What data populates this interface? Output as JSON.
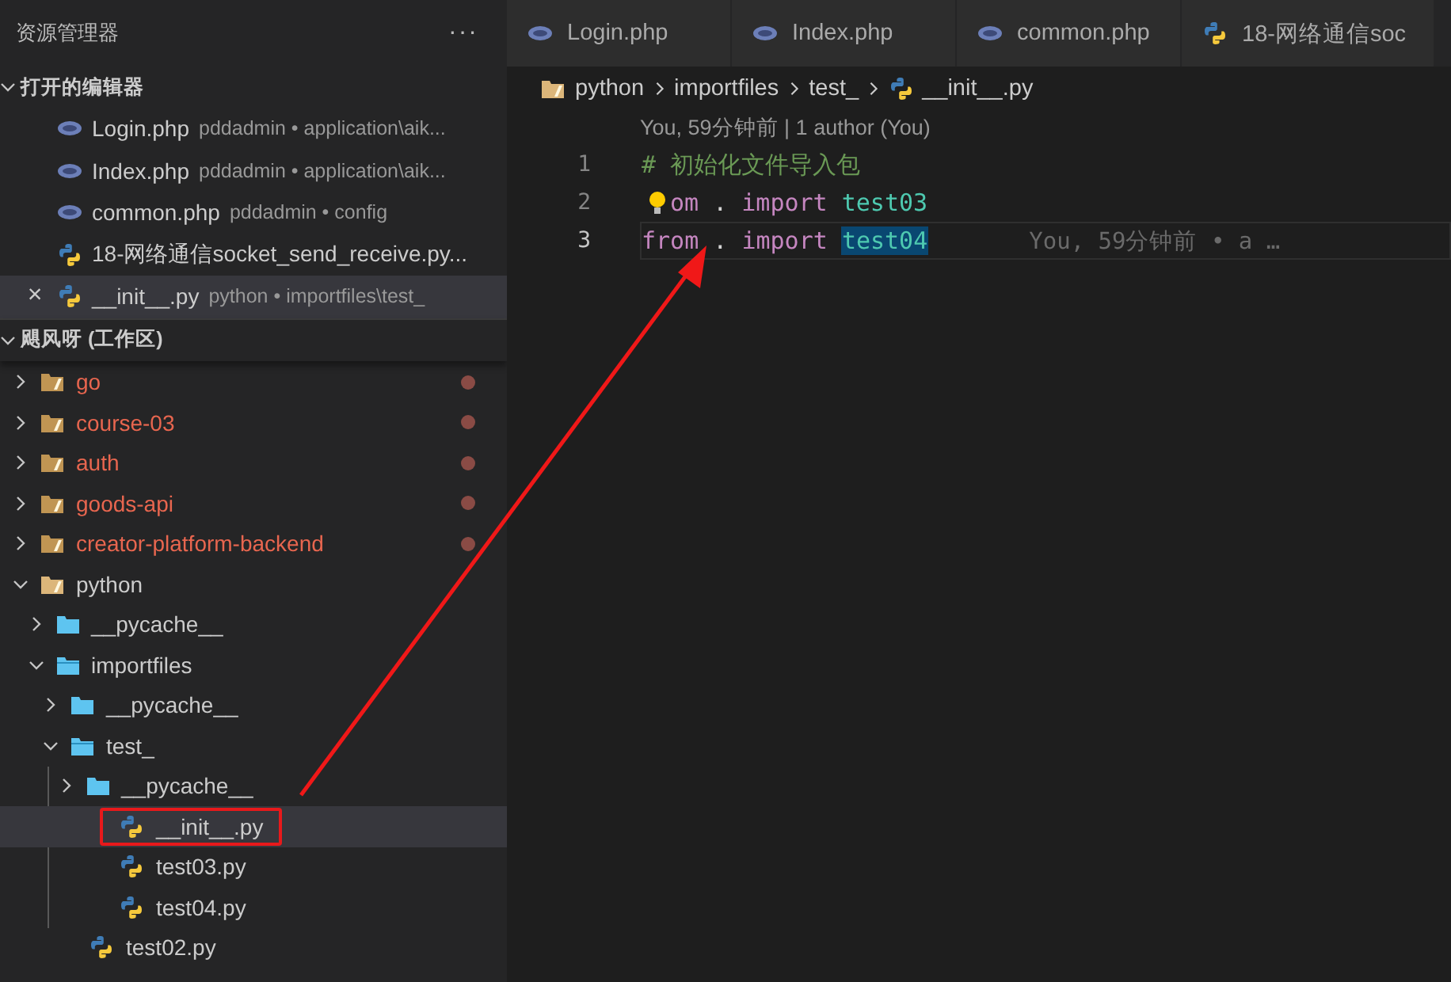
{
  "sidebar": {
    "title": "资源管理器",
    "more": "···",
    "open_editors": {
      "title": "打开的编辑器",
      "expanded": true,
      "items": [
        {
          "name": "Login.php",
          "kind": "php",
          "path": "pddadmin • application\\aik...",
          "selected": false
        },
        {
          "name": "Index.php",
          "kind": "php",
          "path": "pddadmin • application\\aik...",
          "selected": false
        },
        {
          "name": "common.php",
          "kind": "php",
          "path": "pddadmin • config",
          "selected": false
        },
        {
          "name": "18-网络通信socket_send_receive.py...",
          "kind": "python",
          "selected": false
        },
        {
          "name": "__init__.py",
          "kind": "python",
          "path": "python • importfiles\\test_",
          "selected": true,
          "close": "×"
        }
      ]
    },
    "workspace": {
      "title": "飓风呀 (工作区)",
      "expanded": true,
      "tree": [
        {
          "name": "go",
          "kind": "project",
          "expanded": false,
          "modified": true
        },
        {
          "name": "course-03",
          "kind": "project",
          "expanded": false,
          "modified": true
        },
        {
          "name": "auth",
          "kind": "project",
          "expanded": false,
          "modified": true
        },
        {
          "name": "goods-api",
          "kind": "project",
          "expanded": false,
          "modified": true
        },
        {
          "name": "creator-platform-backend",
          "kind": "project",
          "expanded": false,
          "modified": true
        },
        {
          "name": "python",
          "kind": "project",
          "expanded": true,
          "modified": false,
          "children": [
            {
              "name": "__pycache__",
              "kind": "folder",
              "expanded": false,
              "modified": false
            },
            {
              "name": "importfiles",
              "kind": "folder",
              "expanded": true,
              "modified": false,
              "children": [
                {
                  "name": "__pycache__",
                  "kind": "folder",
                  "expanded": false,
                  "modified": false
                },
                {
                  "name": "test_",
                  "kind": "folder",
                  "expanded": true,
                  "modified": false,
                  "children": [
                    {
                      "name": "__pycache__",
                      "kind": "folder",
                      "expanded": false,
                      "modified": false
                    },
                    {
                      "name": "__init__.py",
                      "kind": "python",
                      "selected": true,
                      "highlighted": true,
                      "modified": false
                    },
                    {
                      "name": "test03.py",
                      "kind": "python",
                      "selected": false,
                      "highlighted": false,
                      "modified": false
                    },
                    {
                      "name": "test04.py",
                      "kind": "python",
                      "selected": false,
                      "highlighted": false,
                      "modified": false
                    }
                  ]
                }
              ]
            },
            {
              "name": "test02.py",
              "kind": "python",
              "selected": false,
              "highlighted": false,
              "modified": false
            }
          ]
        }
      ]
    }
  },
  "tabs": [
    {
      "label": "Login.php",
      "kind": "php",
      "selected": false
    },
    {
      "label": "Index.php",
      "kind": "php",
      "selected": false
    },
    {
      "label": "common.php",
      "kind": "php",
      "selected": false
    },
    {
      "label": "18-网络通信soc",
      "kind": "python",
      "selected": false
    }
  ],
  "breadcrumbs": [
    {
      "label": "python",
      "kind": "project"
    },
    {
      "label": "importfiles",
      "kind": "none"
    },
    {
      "label": "test_",
      "kind": "none"
    },
    {
      "label": "__init__.py",
      "kind": "python"
    }
  ],
  "editor": {
    "codelens": "You, 59分钟前 | 1 author (You)",
    "lines": [
      {
        "number": "1",
        "current": false,
        "lightbulb": false,
        "tokens": [
          {
            "text": "# 初始化文件导入包",
            "kind": "comment"
          }
        ]
      },
      {
        "number": "2",
        "current": false,
        "lightbulb": true,
        "tokens": [
          {
            "text": "om",
            "kind": "keyword"
          },
          {
            "text": " . ",
            "kind": "plain"
          },
          {
            "text": "import",
            "kind": "keyword"
          },
          {
            "text": " test03",
            "kind": "module"
          }
        ]
      },
      {
        "number": "3",
        "current": true,
        "lightbulb": false,
        "blame": "You, 59分钟前 • a …",
        "tokens": [
          {
            "text": "from",
            "kind": "keyword"
          },
          {
            "text": " . ",
            "kind": "plain"
          },
          {
            "text": "import ",
            "kind": "keyword"
          },
          {
            "text": "test04",
            "kind": "module-selected"
          }
        ]
      }
    ]
  },
  "annotation": {
    "arrow": true
  }
}
